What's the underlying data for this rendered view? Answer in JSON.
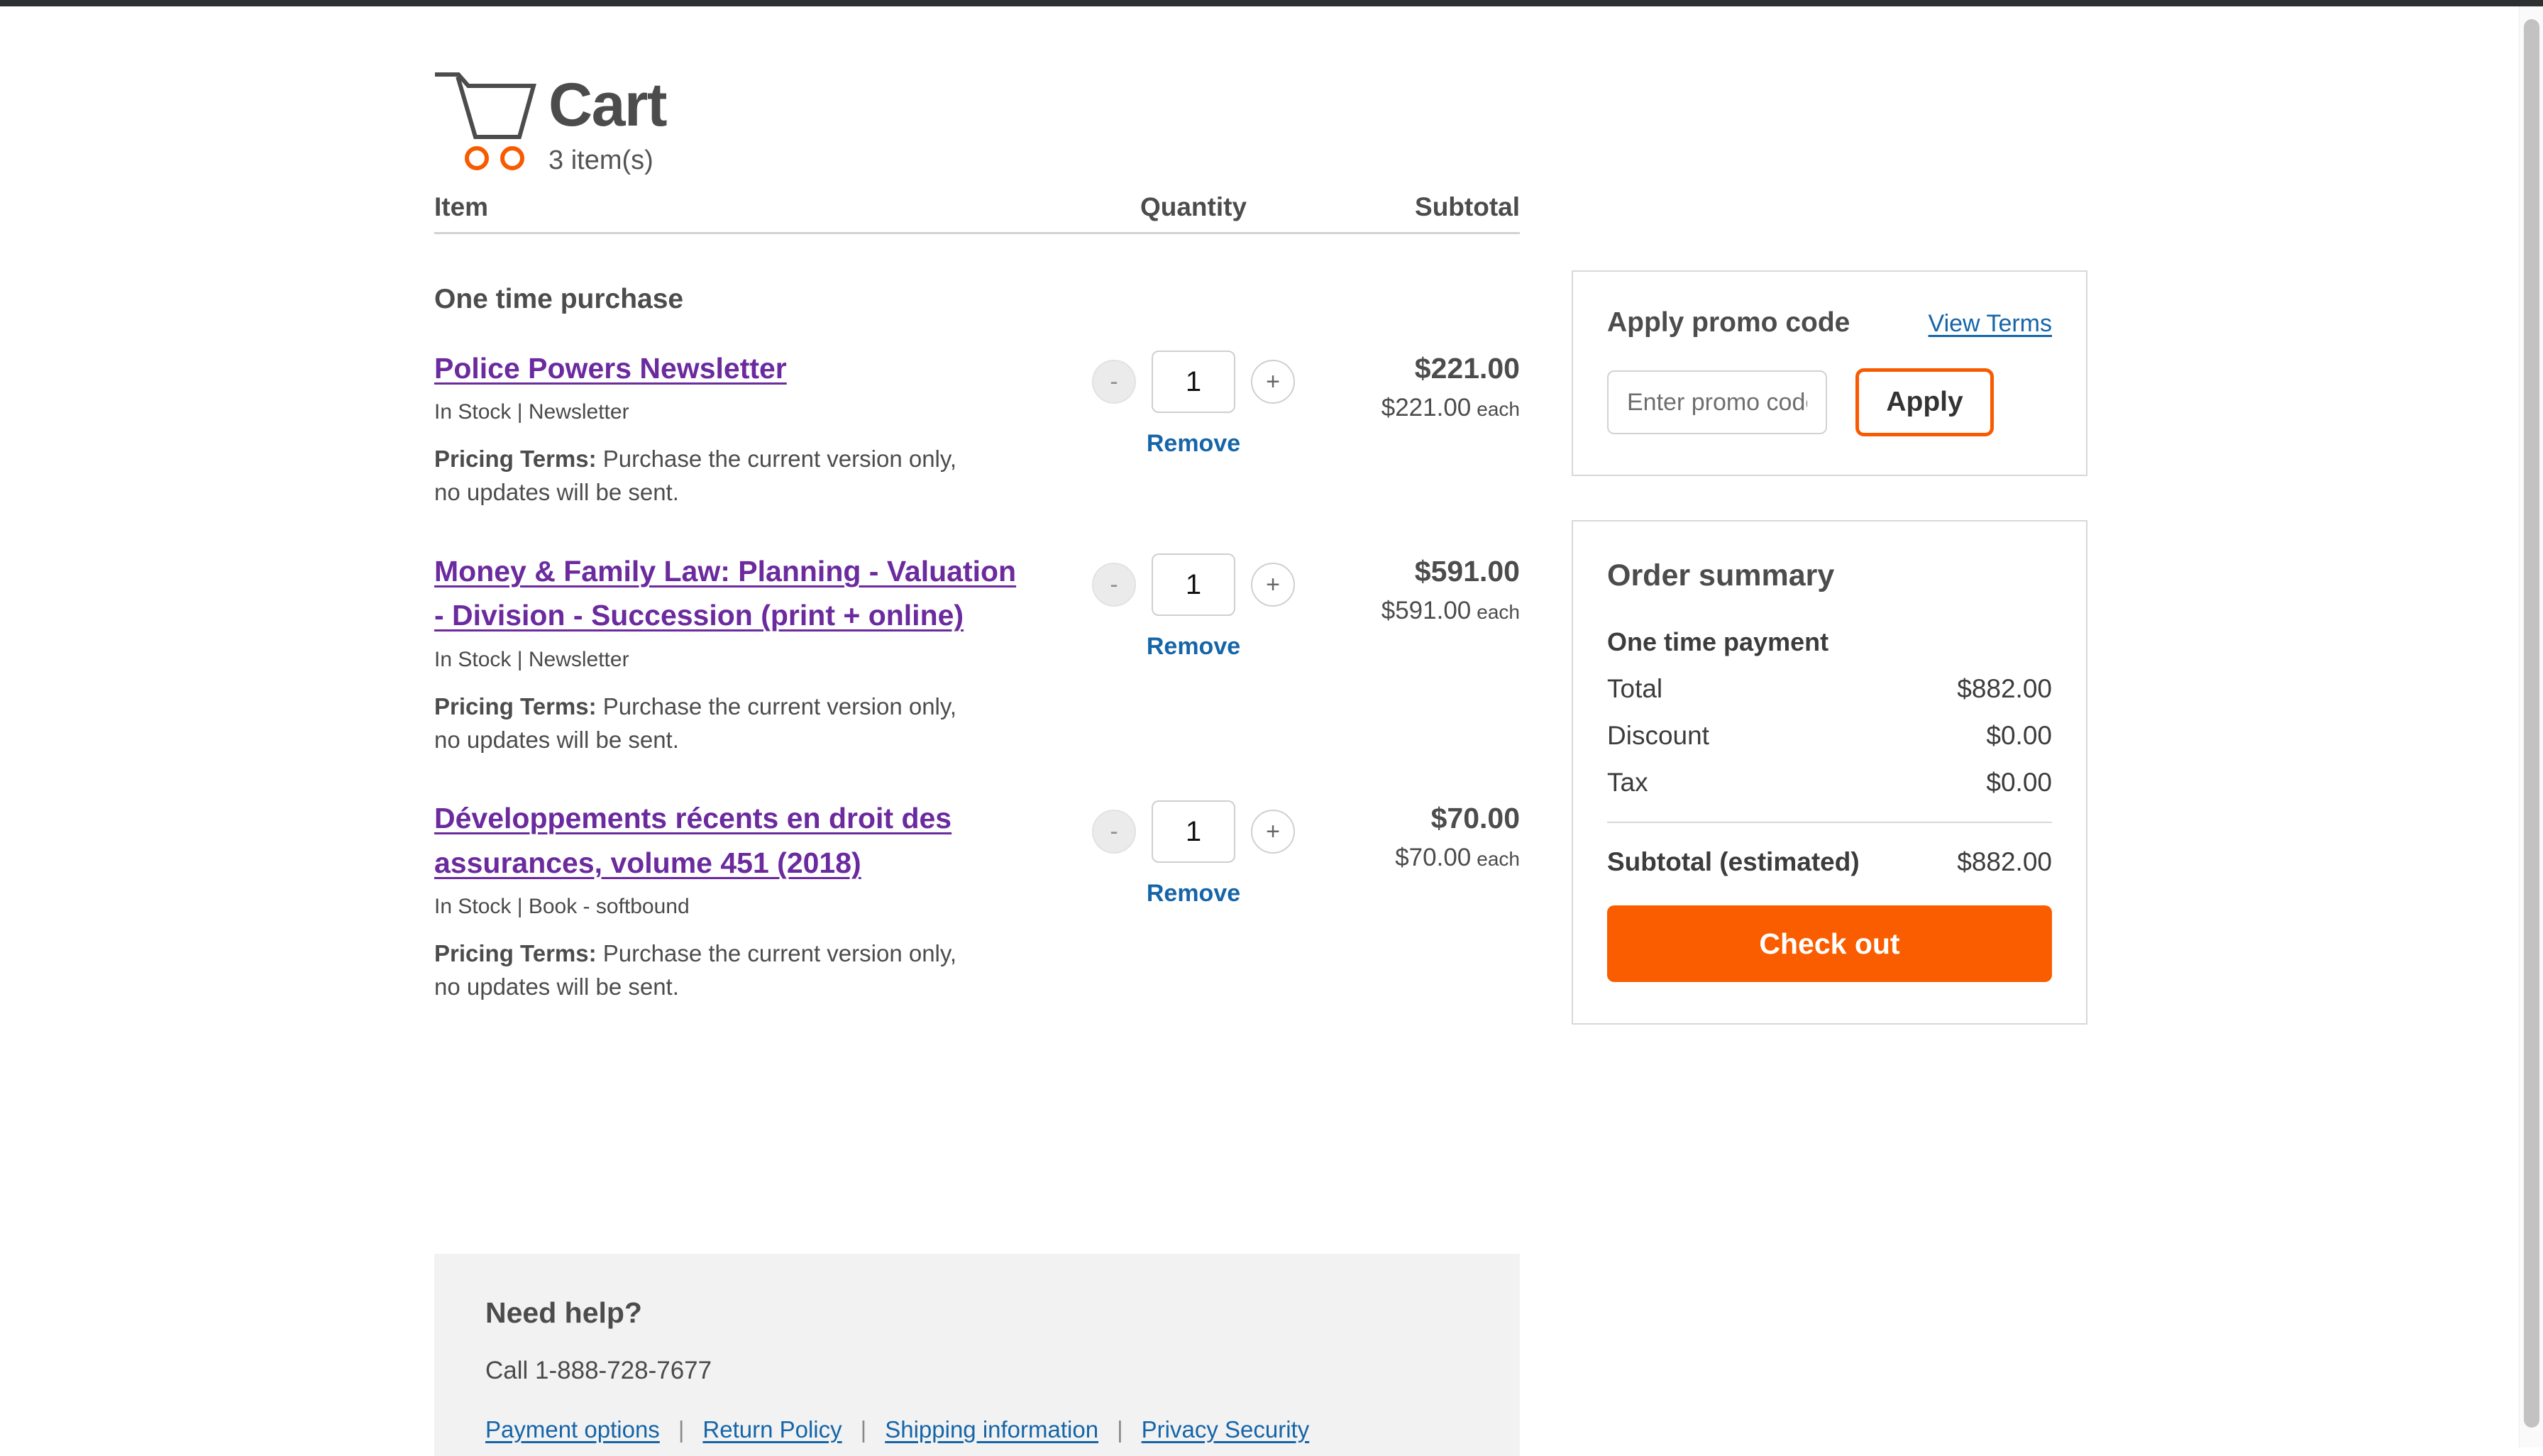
{
  "header": {
    "title": "Cart",
    "item_count_label": "3 item(s)",
    "cart_icon": "shopping-cart-icon",
    "wheel_color": "#f85a00"
  },
  "table": {
    "columns": {
      "item": "Item",
      "quantity": "Quantity",
      "subtotal": "Subtotal"
    },
    "section_title": "One time purchase"
  },
  "items": [
    {
      "name": "Police Powers Newsletter",
      "availability": "In Stock | Newsletter",
      "pricing_terms_label": "Pricing Terms:",
      "pricing_terms_text": " Purchase the current version only, no updates will be sent.",
      "quantity": "1",
      "decrement_label": "-",
      "increment_label": "+",
      "remove_label": "Remove",
      "subtotal": "$221.00",
      "unit_price": "$221.00",
      "unit_suffix": "each",
      "decrement_disabled": true
    },
    {
      "name": "Money & Family Law: Planning - Valuation - Division - Succession (print + online)",
      "availability": "In Stock | Newsletter",
      "pricing_terms_label": "Pricing Terms:",
      "pricing_terms_text": " Purchase the current version only, no updates will be sent.",
      "quantity": "1",
      "decrement_label": "-",
      "increment_label": "+",
      "remove_label": "Remove",
      "subtotal": "$591.00",
      "unit_price": "$591.00",
      "unit_suffix": "each",
      "decrement_disabled": true
    },
    {
      "name": "Développements récents en droit des assurances, volume 451 (2018)",
      "availability": "In Stock | Book - softbound",
      "pricing_terms_label": "Pricing Terms:",
      "pricing_terms_text": " Purchase the current version only, no updates will be sent.",
      "quantity": "1",
      "decrement_label": "-",
      "increment_label": "+",
      "remove_label": "Remove",
      "subtotal": "$70.00",
      "unit_price": "$70.00",
      "unit_suffix": "each",
      "decrement_disabled": true
    }
  ],
  "promo": {
    "title": "Apply promo code",
    "view_terms_label": "View Terms",
    "input_placeholder": "Enter promo code",
    "input_value": "",
    "apply_label": "Apply",
    "apply_border_color": "#f85a00"
  },
  "summary": {
    "title": "Order summary",
    "payment_type": "One time payment",
    "lines": [
      {
        "label": "Total",
        "value": "$882.00"
      },
      {
        "label": "Discount",
        "value": "$0.00"
      },
      {
        "label": "Tax",
        "value": "$0.00"
      }
    ],
    "subtotal_label": "Subtotal (estimated)",
    "subtotal_value": "$882.00",
    "checkout_label": "Check out",
    "checkout_color": "#fa5d00"
  },
  "help": {
    "title": "Need help?",
    "phone": "Call 1-888-728-7677",
    "links": [
      "Payment options",
      "Return Policy",
      "Shipping information",
      "Privacy Security"
    ],
    "separator": "|"
  },
  "theme": {
    "product_link_color": "#6b2a9e",
    "action_link_color": "#1565a8",
    "accent_orange": "#fa5d00"
  }
}
